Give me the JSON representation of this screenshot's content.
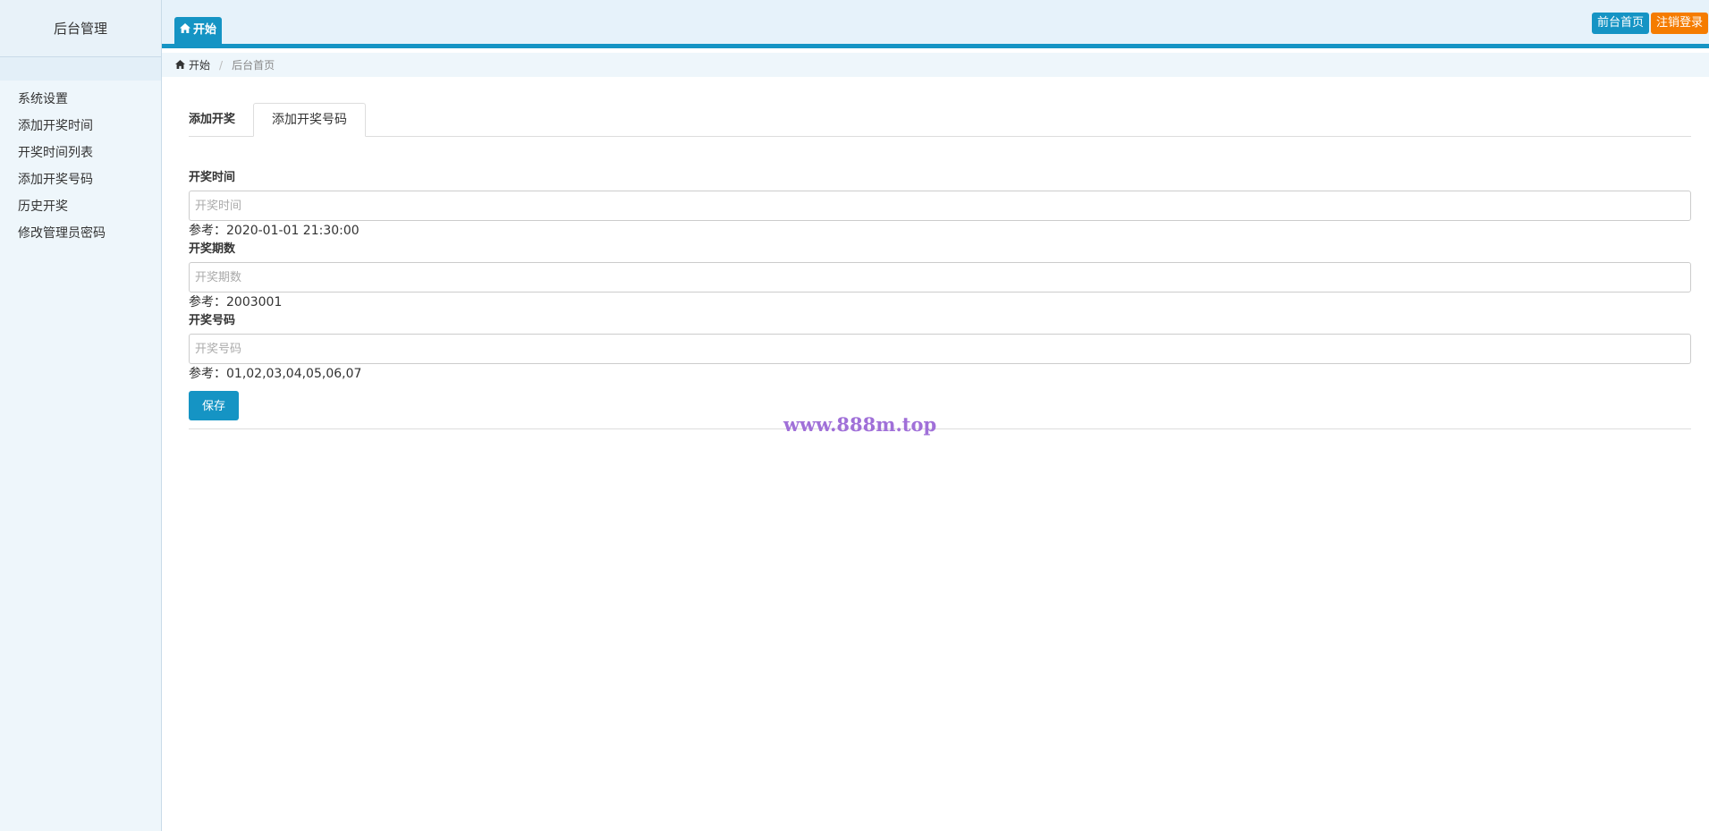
{
  "sidebar": {
    "title": "后台管理",
    "items": [
      {
        "label": "系统设置"
      },
      {
        "label": "添加开奖时间"
      },
      {
        "label": "开奖时间列表"
      },
      {
        "label": "添加开奖号码"
      },
      {
        "label": "历史开奖"
      },
      {
        "label": "修改管理员密码"
      }
    ]
  },
  "topbar": {
    "tab_label": "开始",
    "tab_icon": "home-icon",
    "front_page_label": "前台首页",
    "logout_label": "注销登录",
    "colors": {
      "primary": "#1594c4",
      "logout": "#f57c00"
    }
  },
  "breadcrumb": {
    "home_label": "开始",
    "home_icon": "home-icon",
    "current": "后台首页"
  },
  "tabs": [
    {
      "label": "添加开奖",
      "active": false
    },
    {
      "label": "添加开奖号码",
      "active": true
    }
  ],
  "form": {
    "fields": [
      {
        "label": "开奖时间",
        "placeholder": "开奖时间",
        "value": "",
        "help": "参考：2020-01-01 21:30:00"
      },
      {
        "label": "开奖期数",
        "placeholder": "开奖期数",
        "value": "",
        "help": "参考：2003001"
      },
      {
        "label": "开奖号码",
        "placeholder": "开奖号码",
        "value": "",
        "help": "参考：01,02,03,04,05,06,07"
      }
    ],
    "save_label": "保存"
  },
  "watermark": "www.888m.top"
}
